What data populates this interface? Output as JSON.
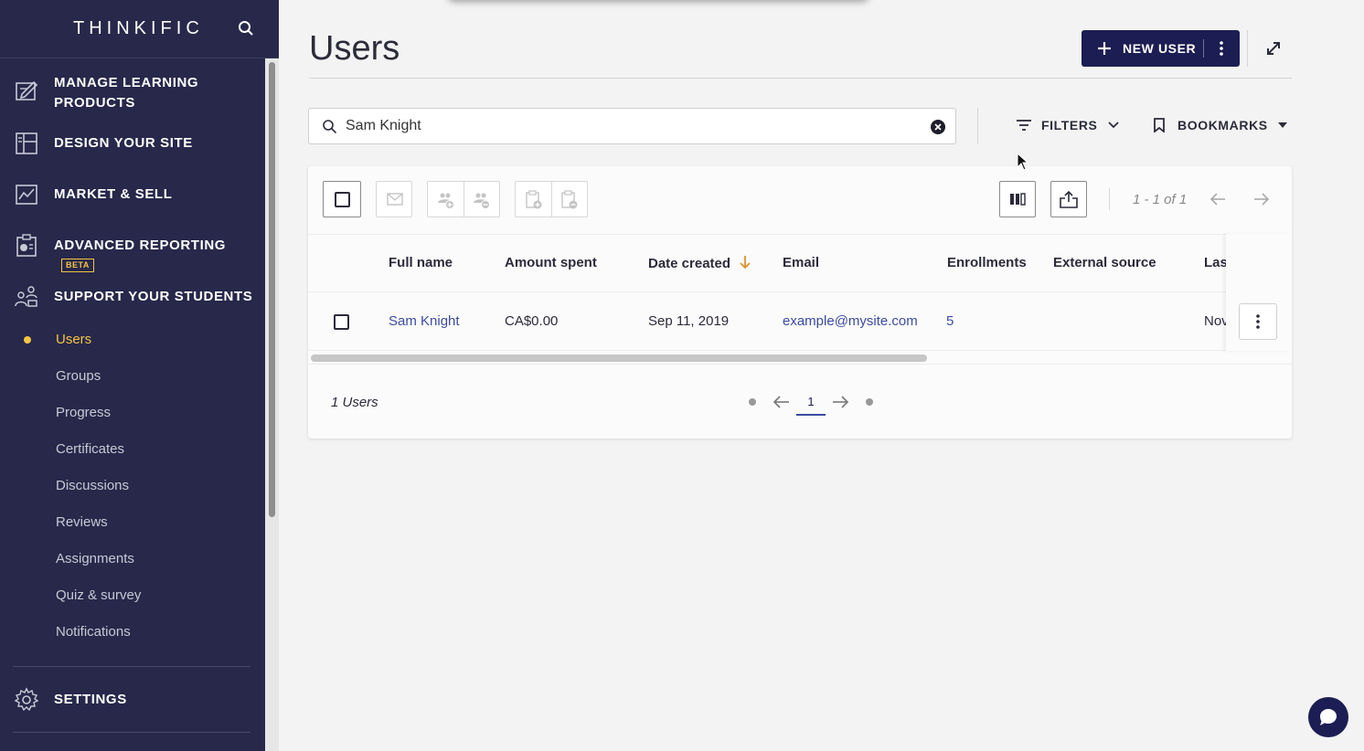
{
  "brand": {
    "logo": "THINKIFIC"
  },
  "sidebar": {
    "sections": [
      {
        "label": "MANAGE LEARNING PRODUCTS",
        "icon": "pencil-square-icon"
      },
      {
        "label": "DESIGN YOUR SITE",
        "icon": "layout-icon"
      },
      {
        "label": "MARKET & SELL",
        "icon": "chart-line-icon"
      },
      {
        "label": "ADVANCED REPORTING",
        "badge": "BETA",
        "icon": "report-clipboard-icon"
      },
      {
        "label": "SUPPORT YOUR STUDENTS",
        "icon": "students-icon"
      }
    ],
    "sub_items": [
      "Users",
      "Groups",
      "Progress",
      "Certificates",
      "Discussions",
      "Reviews",
      "Assignments",
      "Quiz & survey",
      "Notifications"
    ],
    "active_sub_item": "Users",
    "settings": {
      "label": "SETTINGS",
      "icon": "gear-icon"
    }
  },
  "header": {
    "title": "Users",
    "new_user_label": "NEW USER"
  },
  "search": {
    "value": "Sam Knight"
  },
  "filters_label": "FILTERS",
  "bookmarks_label": "BOOKMARKS",
  "toolbar": {
    "range": "1 - 1 of 1"
  },
  "table": {
    "columns": [
      "Full name",
      "Amount spent",
      "Date created",
      "Email",
      "Enrollments",
      "External source",
      "Last"
    ],
    "sorted_column": "Date created",
    "rows": [
      {
        "full_name": "Sam Knight",
        "amount_spent": "CA$0.00",
        "date_created": "Sep 11, 2019",
        "email": "example@mysite.com",
        "enrollments": "5",
        "external_source": "",
        "last": "Nov"
      }
    ]
  },
  "footer": {
    "count": "1 Users",
    "page": "1"
  },
  "colors": {
    "sidebar_bg": "#27284a",
    "accent_yellow": "#f4c542",
    "primary": "#1c1d52",
    "link": "#3b4ba0"
  }
}
